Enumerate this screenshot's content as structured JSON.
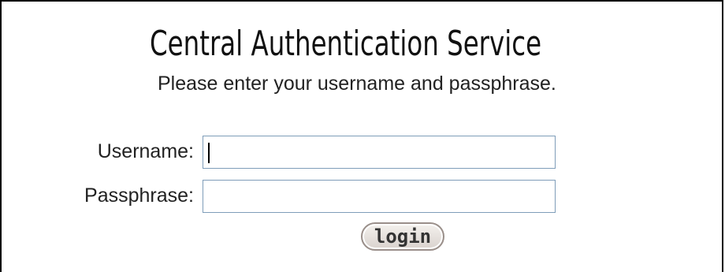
{
  "header": {
    "title": "Central Authentication Service",
    "subtitle": "Please enter your username and passphrase."
  },
  "form": {
    "username": {
      "label": "Username:",
      "value": ""
    },
    "passphrase": {
      "label": "Passphrase:",
      "value": ""
    },
    "submit_label": "login"
  }
}
